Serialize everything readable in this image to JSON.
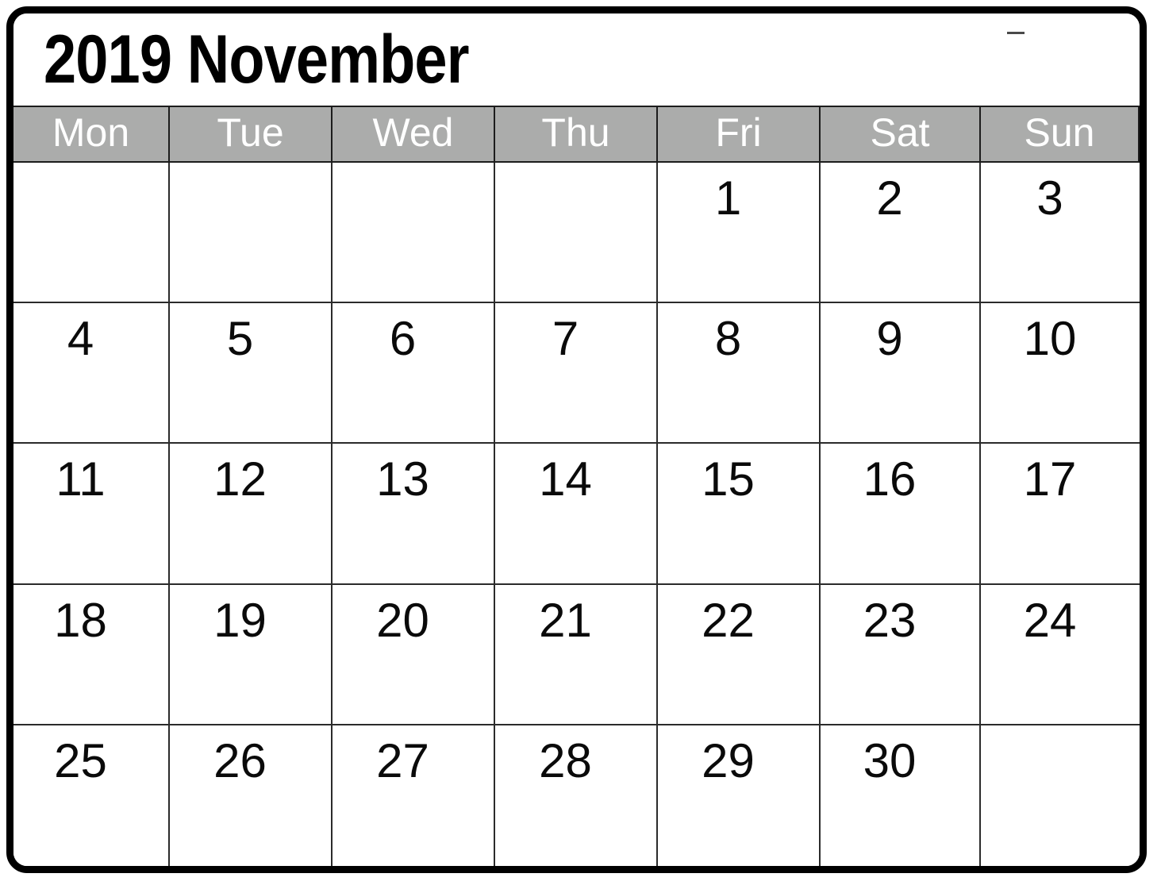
{
  "document": {
    "type": "printable-monthly-calendar",
    "title": "2019 November",
    "year": "2019",
    "month": "November"
  },
  "theme": {
    "header_background": "#abacab",
    "header_text": "#ffffff",
    "grid_line": "#2b2b2b",
    "frame": "#000000",
    "page_background": "#ffffff",
    "day_number_text": "#0a0a0a"
  },
  "weekdays": [
    {
      "label": "Mon",
      "name": "monday"
    },
    {
      "label": "Tue",
      "name": "tuesday"
    },
    {
      "label": "Wed",
      "name": "wednesday"
    },
    {
      "label": "Thu",
      "name": "thursday"
    },
    {
      "label": "Fri",
      "name": "friday"
    },
    {
      "label": "Sat",
      "name": "saturday"
    },
    {
      "label": "Sun",
      "name": "sunday"
    }
  ],
  "weeks": [
    {
      "days": [
        "",
        "",
        "",
        "",
        "1",
        "2",
        "3"
      ]
    },
    {
      "days": [
        "4",
        "5",
        "6",
        "7",
        "8",
        "9",
        "10"
      ]
    },
    {
      "days": [
        "11",
        "12",
        "13",
        "14",
        "15",
        "16",
        "17"
      ]
    },
    {
      "days": [
        "18",
        "19",
        "20",
        "21",
        "22",
        "23",
        "24"
      ]
    },
    {
      "days": [
        "25",
        "26",
        "27",
        "28",
        "29",
        "30",
        ""
      ]
    }
  ]
}
